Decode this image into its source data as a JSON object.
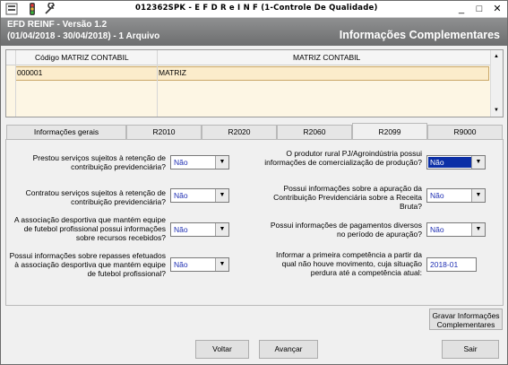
{
  "window": {
    "title": "012362SPK - E F D   R e I N F (1-Controle De Qualidade)"
  },
  "header": {
    "app_version": "EFD REINF - Versão 1.2",
    "period": "(01/04/2018 - 30/04/2018) - 1 Arquivo",
    "section_title": "Informações Complementares"
  },
  "grid": {
    "columns": [
      "Código MATRIZ CONTABIL",
      "MATRIZ CONTABIL"
    ],
    "rows": [
      [
        "000001",
        "MATRIZ"
      ]
    ]
  },
  "tabs": [
    {
      "label": "Informações gerais"
    },
    {
      "label": "R2010"
    },
    {
      "label": "R2020"
    },
    {
      "label": "R2060"
    },
    {
      "label": "R2099"
    },
    {
      "label": "R9000"
    }
  ],
  "form": {
    "q1": {
      "label": "Prestou serviços sujeitos à retenção de contribuição previdenciária?",
      "value": "Não"
    },
    "q2": {
      "label": "Contratou serviços sujeitos à retenção de contribuição previdenciária?",
      "value": "Não"
    },
    "q3": {
      "label": "A associação desportiva que mantém equipe de futebol profissional possui informações sobre recursos recebidos?",
      "value": "Não"
    },
    "q4": {
      "label": "Possui informações sobre repasses efetuados à associação desportiva que mantém equipe de futebol profissional?",
      "value": "Não"
    },
    "q5": {
      "label": "O produtor rural PJ/Agroindústria possui informações de comercialização de produção?",
      "value": "Não"
    },
    "q6": {
      "label": "Possui informações sobre a apuração da Contribuição Previdenciária sobre a Receita Bruta?",
      "value": "Não"
    },
    "q7": {
      "label": "Possui informações de pagamentos diversos no período de apuração?",
      "value": "Não"
    },
    "q8": {
      "label": "Informar a primeira competência a partir da qual não houve movimento, cuja situação perdura até a competência atual:",
      "value": "2018-01"
    }
  },
  "buttons": {
    "save": "Gravar Informações Complementares",
    "back": "Voltar",
    "next": "Avançar",
    "exit": "Sair"
  }
}
